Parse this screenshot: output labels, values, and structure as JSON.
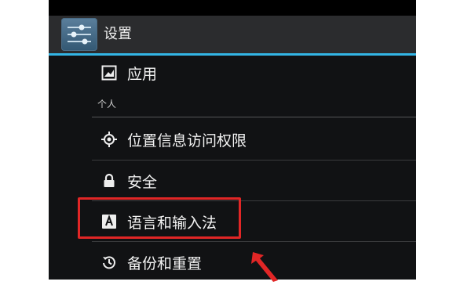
{
  "action_bar": {
    "title": "设置",
    "app_icon": "settings-sliders-icon"
  },
  "section_header": "个人",
  "items": [
    {
      "label": "应用",
      "icon": "apps-image-icon"
    },
    {
      "label": "位置信息访问权限",
      "icon": "location-icon"
    },
    {
      "label": "安全",
      "icon": "lock-icon"
    },
    {
      "label": "语言和输入法",
      "icon": "language-icon"
    },
    {
      "label": "备份和重置",
      "icon": "backup-icon"
    }
  ],
  "annotation": {
    "color": "#e12626",
    "target": "语言和输入法"
  },
  "colors": {
    "accent": "#33b5e5",
    "background": "#111214",
    "action_bar": "#2b2c2e"
  }
}
